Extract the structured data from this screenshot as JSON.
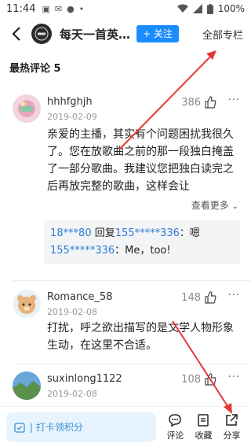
{
  "status": {
    "time": "11:44",
    "battery": "100%"
  },
  "header": {
    "album_title": "每天一首英文歌",
    "follow_label": "+ 关注",
    "all_columns_label": "全部专栏"
  },
  "section": {
    "title": "最热评论 5"
  },
  "comments": [
    {
      "user": "hhhfghjh",
      "date": "2019-02-09",
      "likes": "386",
      "text": "亲爱的主播，其实有个问题困扰我很久了。您在放歌曲之前的那一段独白掩盖了一部分歌曲。我建议您把独白读完之后再放完整的歌曲，这样会让",
      "see_more": "查看更多",
      "replies": [
        {
          "from": "18***80",
          "verb": "回复",
          "to": "155*****336",
          "text": "：嗯"
        },
        {
          "from": "155*****336",
          "text": "：Me，too!"
        }
      ]
    },
    {
      "user": "Romance_58",
      "date": "2019-02-08",
      "likes": "148",
      "text": "打扰，呼之欲出描写的是文学人物形象生动，在这里不合适。"
    },
    {
      "user": "suxinlong1122",
      "date": "2019-02-08",
      "likes": "108"
    }
  ],
  "bottom": {
    "checkin_label": "| 打卡领积分",
    "comment_label": "评论",
    "collect_label": "收藏",
    "share_label": "分享"
  },
  "colors": {
    "accent": "#1a8cff",
    "annotation_arrow": "#e53935",
    "checkin_bg": "#e8f4fd"
  }
}
